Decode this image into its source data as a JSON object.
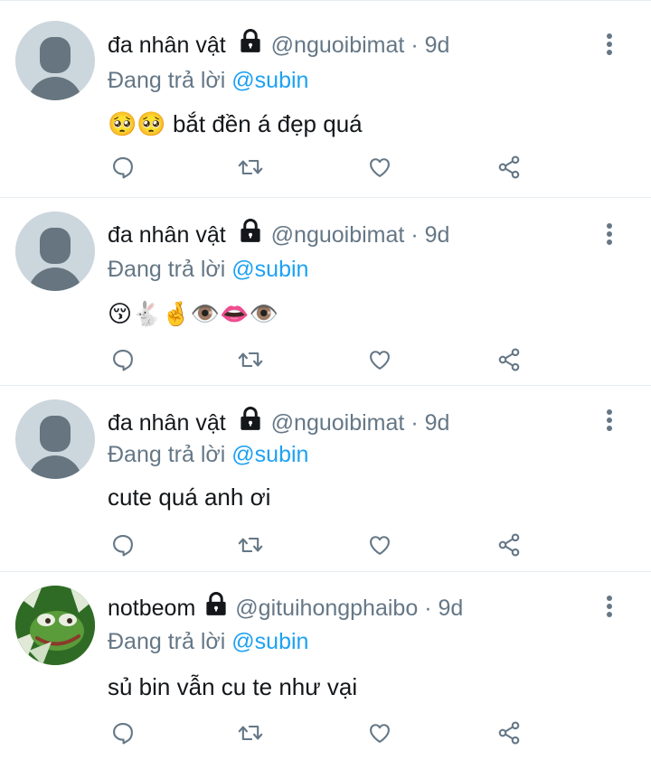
{
  "tweets": [
    {
      "display_name": "đa nhân vật",
      "handle": "@nguoibimat",
      "separator": "·",
      "time": "9d",
      "reply_prefix": "Đang trả lời",
      "reply_to": "@subin",
      "text": "🥺🥺 bắt đền á đẹp quá",
      "avatar": "default-avatar-icon",
      "locked": true
    },
    {
      "display_name": "đa nhân vật",
      "handle": "@nguoibimat",
      "separator": "·",
      "time": "9d",
      "reply_prefix": "Đang trả lời",
      "reply_to": "@subin",
      "text": "😚🐇🤞👁️👄👁️",
      "avatar": "default-avatar-icon",
      "locked": true
    },
    {
      "display_name": "đa nhân vật",
      "handle": "@nguoibimat",
      "separator": "·",
      "time": "9d",
      "reply_prefix": "Đang trả lời",
      "reply_to": "@subin",
      "text": "cute quá anh ơi",
      "avatar": "default-avatar-icon",
      "locked": true
    },
    {
      "display_name": "notbeom",
      "handle": "@gituihongphaibo",
      "separator": "·",
      "time": "9d",
      "reply_prefix": "Đang trả lời",
      "reply_to": "@subin",
      "text": "sủ bin vẫn cu te như vại",
      "avatar": "frog-avatar-image",
      "locked": true
    }
  ],
  "icons": {
    "reply": "reply-bubble-icon",
    "retweet": "retweet-icon",
    "like": "heart-icon",
    "share": "share-icon",
    "menu": "more-vertical-icon",
    "lock": "lock-icon"
  },
  "colors": {
    "text": "#14171a",
    "secondary": "#657786",
    "mention": "#1da1f2",
    "divider": "#e6ecf0",
    "avatar_bg": "#ccd6dd",
    "avatar_fg": "#66757f"
  }
}
